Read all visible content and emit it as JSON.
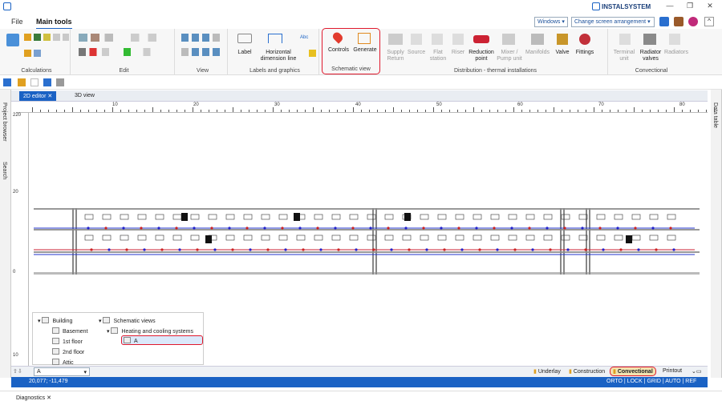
{
  "title_bar": {
    "brand": "INSTALSYSTEM",
    "controls": [
      "—",
      "❐",
      "✕"
    ]
  },
  "menu": {
    "tabs": [
      "File",
      "Main tools"
    ],
    "active": "Main tools"
  },
  "top_right": {
    "windows_label": "Windows",
    "arrangement_label": "Change screen arrangement"
  },
  "ribbon": {
    "groups": [
      "Calculations",
      "Edit",
      "View",
      "Labels and graphics",
      "Schematic view",
      "Distribution - thermal installations",
      "Convectional"
    ],
    "labels_graphics": {
      "label": "Label",
      "dimension": "Horizontal\ndimension line"
    },
    "schematic": {
      "controls": "Controls",
      "generate": "Generate"
    },
    "distribution": [
      "Supply\nReturn",
      "Source",
      "Flat\nstation",
      "Riser",
      "Reduction\npoint",
      "Mixer /\nPump unit",
      "Manifolds",
      "Valve",
      "Fittings"
    ],
    "convectional": [
      "Terminal\nunit",
      "Radiator\nvalves",
      "Radiators"
    ]
  },
  "side_left": {
    "project_browser": "Project browser",
    "search": "Search"
  },
  "side_right": {
    "data_table": "Data table"
  },
  "doc_tabs": {
    "editor": "2D editor",
    "view3d": "3D view"
  },
  "ruler": {
    "h_ticks": [
      "10",
      "20",
      "30",
      "40",
      "50",
      "60",
      "70",
      "80"
    ],
    "v_ticks": [
      "0",
      "10",
      "20",
      "10",
      "220"
    ]
  },
  "tree": {
    "building": "Building",
    "floors": [
      "Basement",
      "1st floor",
      "2nd floor",
      "Attic"
    ],
    "schematic_views": "Schematic views",
    "heating": "Heating and cooling systems",
    "selected": "A"
  },
  "bottom": {
    "view_select": "A",
    "links": [
      "Underlay",
      "Construction",
      "Convectional",
      "Printout"
    ],
    "active_link": "Convectional"
  },
  "status": {
    "coords": "20,077; -11,479",
    "modes": "ORTO | LOCK | GRID | AUTO | REF"
  },
  "diagnostics": "Diagnostics"
}
